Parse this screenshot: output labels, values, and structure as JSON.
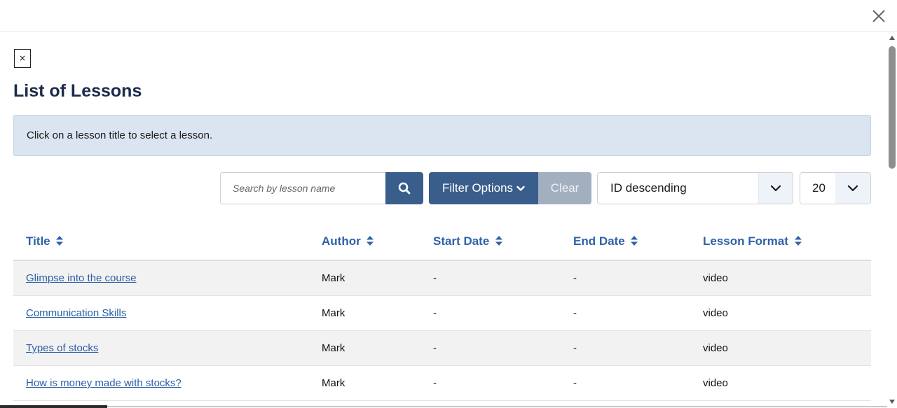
{
  "modal": {
    "close_icon": "close-x-icon"
  },
  "panel": {
    "close_glyph": "×"
  },
  "page_title": "List of Lessons",
  "info_message": "Click on a lesson title to select a lesson.",
  "search": {
    "placeholder": "Search by lesson name",
    "value": "",
    "icon": "search-icon"
  },
  "filter": {
    "label": "Filter Options",
    "icon": "chevron-down-icon",
    "clear_label": "Clear"
  },
  "sort_select": {
    "value": "ID descending"
  },
  "page_size_select": {
    "value": "20"
  },
  "colors": {
    "primary": "#3a5e8c",
    "clear": "#a2afbf",
    "link": "#2a5ea4",
    "header_text": "#2e62a8",
    "info_bg": "#dbe4f1"
  },
  "table": {
    "columns": [
      "Title",
      "Author",
      "Start Date",
      "End Date",
      "Lesson Format"
    ],
    "rows": [
      {
        "title": "Glimpse into the course",
        "author": "Mark",
        "start_date": "-",
        "end_date": "-",
        "format": "video"
      },
      {
        "title": "Communication Skills",
        "author": "Mark",
        "start_date": "-",
        "end_date": "-",
        "format": "video"
      },
      {
        "title": "Types of stocks",
        "author": "Mark",
        "start_date": "-",
        "end_date": "-",
        "format": "video"
      },
      {
        "title": "How is money made with stocks?",
        "author": "Mark",
        "start_date": "-",
        "end_date": "-",
        "format": "video"
      }
    ]
  }
}
